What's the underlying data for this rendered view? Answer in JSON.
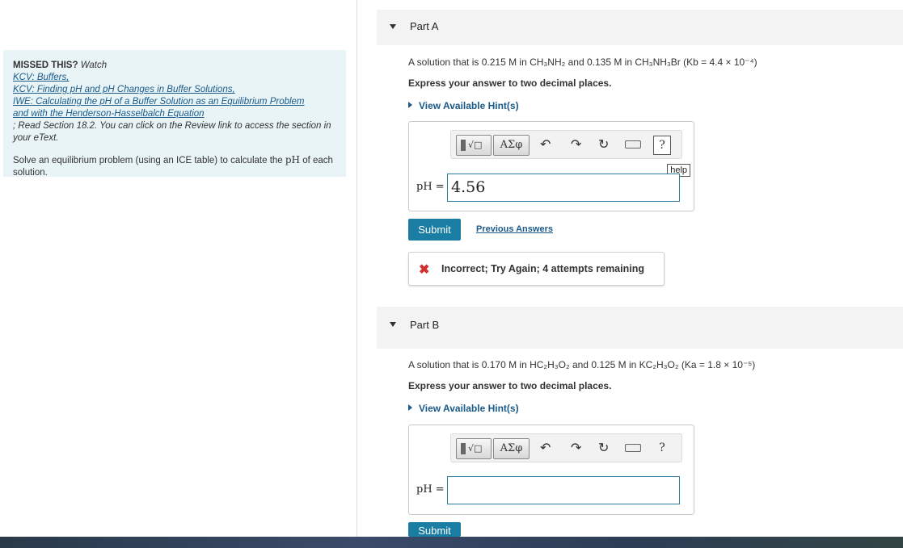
{
  "left_panel": {
    "missed_label": "MISSED THIS?",
    "watch_label": " Watch ",
    "links": [
      "KCV: Buffers,",
      "KCV: Finding pH and pH Changes in Buffer Solutions,",
      "IWE: Calculating the pH of a Buffer Solution as an Equilibrium Problem",
      "and with the Henderson-Hasselbalch Equation"
    ],
    "review_text": "; Read Section 18.2. You can click on the Review link to access the section in your eText.",
    "solve_text_before": "Solve an equilibrium problem (using an ICE table) to calculate the ",
    "solve_math": "pH",
    "solve_text_after": " of each solution."
  },
  "part_a": {
    "title": "Part A",
    "question": "A solution that is 0.215 M in CH₃NH₂ and 0.135 M in CH₃NH₃Br (Kb = 4.4 × 10⁻⁴)",
    "instruction": "Express your answer to two decimal places.",
    "hint": "View Available Hint(s)",
    "toolbar": {
      "greek": "ΑΣφ",
      "undo": "↶",
      "redo": "↷",
      "reset": "↻",
      "help_q": "?",
      "help_tip": "help"
    },
    "ph_label": "pH =",
    "ph_value": "4.56",
    "submit": "Submit",
    "previous_answers": "Previous Answers",
    "feedback": "Incorrect; Try Again; 4 attempts remaining",
    "feedback_icon": "✖"
  },
  "part_b": {
    "title": "Part B",
    "question": "A solution that is 0.170 M in HC₂H₃O₂ and 0.125 M in KC₂H₃O₂ (Ka = 1.8 × 10⁻⁵)",
    "instruction": "Express your answer to two decimal places.",
    "hint": "View Available Hint(s)",
    "toolbar": {
      "greek": "ΑΣφ",
      "undo": "↶",
      "redo": "↷",
      "reset": "↻",
      "help_q": "?"
    },
    "ph_label": "pH =",
    "ph_value": "",
    "submit": "Submit"
  }
}
